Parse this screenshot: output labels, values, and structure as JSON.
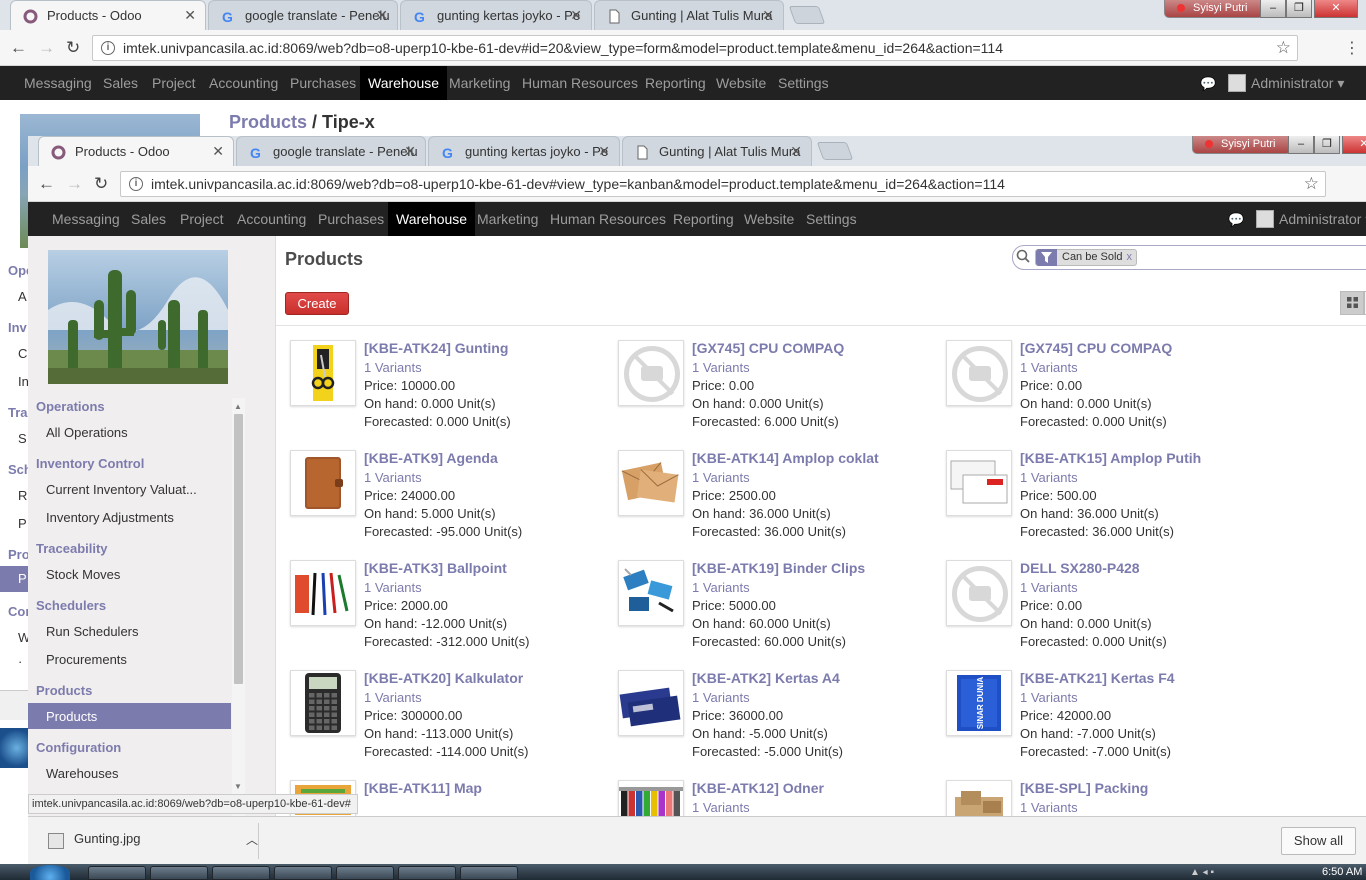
{
  "bg": {
    "tabs": [
      {
        "title": "Products - Odoo",
        "icon": "odoo-icon"
      },
      {
        "title": "google translate - Penelu",
        "icon": "google-icon"
      },
      {
        "title": "gunting kertas joyko - Pe",
        "icon": "google-icon"
      },
      {
        "title": "Gunting | Alat Tulis Mura",
        "icon": "page-icon"
      }
    ],
    "user": "Syisyi Putri",
    "url": "imtek.univpancasila.ac.id:8069/web?db=o8-uperp10-kbe-61-dev#id=20&view_type=form&model=product.template&menu_id=264&action=114",
    "breadcrumb_link": "Products",
    "breadcrumb_sep": " / ",
    "breadcrumb_current": "Tipe-x",
    "side_fragments": [
      "Ope",
      "A",
      "Inv",
      "C",
      "In",
      "Tra",
      "S",
      "Sch",
      "R",
      "P",
      "Pro",
      "P",
      "Con",
      "W",
      "·"
    ]
  },
  "window_controls": {
    "minimize": "–",
    "restore": "❐",
    "close": "✕"
  },
  "tabs": [
    {
      "title": "Products - Odoo",
      "icon": "odoo-icon"
    },
    {
      "title": "google translate - Penelu",
      "icon": "google-icon"
    },
    {
      "title": "gunting kertas joyko - Pe",
      "icon": "google-icon"
    },
    {
      "title": "Gunting | Alat Tulis Mura",
      "icon": "page-icon"
    }
  ],
  "user": "Syisyi Putri",
  "url": "imtek.univpancasila.ac.id:8069/web?db=o8-uperp10-kbe-61-dev#view_type=kanban&model=product.template&menu_id=264&action=114",
  "topmenu": [
    "Messaging",
    "Sales",
    "Project",
    "Accounting",
    "Purchases",
    "Warehouse",
    "Marketing",
    "Human Resources",
    "Reporting",
    "Website",
    "Settings"
  ],
  "active_menu": "Warehouse",
  "admin": "Administrator",
  "sidebar": {
    "sections": [
      {
        "title": "Operations",
        "items": [
          "All Operations"
        ]
      },
      {
        "title": "Inventory Control",
        "items": [
          "Current Inventory Valuat...",
          "Inventory Adjustments"
        ]
      },
      {
        "title": "Traceability",
        "items": [
          "Stock Moves"
        ]
      },
      {
        "title": "Schedulers",
        "items": [
          "Run Schedulers",
          "Procurements"
        ]
      },
      {
        "title": "Products",
        "items": [
          "Products"
        ]
      },
      {
        "title": "Configuration",
        "items": [
          "Warehouses"
        ]
      }
    ],
    "active_item": "Products"
  },
  "page_title": "Products",
  "create_label": "Create",
  "search": {
    "facet": "Can be Sold",
    "facet_remove": "x"
  },
  "products": [
    {
      "name": "[KBE-ATK24] Gunting",
      "variants": "1 Variants",
      "price": "Price: 10000.00",
      "onhand": "On hand: 0.000 Unit(s)",
      "forecast": "Forecasted: 0.000 Unit(s)",
      "img": "scissors"
    },
    {
      "name": "[GX745] CPU COMPAQ",
      "variants": "1 Variants",
      "price": "Price: 0.00",
      "onhand": "On hand: 0.000 Unit(s)",
      "forecast": "Forecasted: 6.000 Unit(s)",
      "img": "none"
    },
    {
      "name": "[GX745] CPU COMPAQ",
      "variants": "1 Variants",
      "price": "Price: 0.00",
      "onhand": "On hand: 0.000 Unit(s)",
      "forecast": "Forecasted: 0.000 Unit(s)",
      "img": "none"
    },
    {
      "name": "[KBE-ATK9] Agenda",
      "variants": "1 Variants",
      "price": "Price: 24000.00",
      "onhand": "On hand: 5.000 Unit(s)",
      "forecast": "Forecasted: -95.000 Unit(s)",
      "img": "agenda"
    },
    {
      "name": "[KBE-ATK14] Amplop coklat",
      "variants": "1 Variants",
      "price": "Price: 2500.00",
      "onhand": "On hand: 36.000 Unit(s)",
      "forecast": "Forecasted: 36.000 Unit(s)",
      "img": "envelope-brown"
    },
    {
      "name": "[KBE-ATK15] Amplop Putih",
      "variants": "1 Variants",
      "price": "Price: 500.00",
      "onhand": "On hand: 36.000 Unit(s)",
      "forecast": "Forecasted: 36.000 Unit(s)",
      "img": "envelope-white"
    },
    {
      "name": "[KBE-ATK3] Ballpoint",
      "variants": "1 Variants",
      "price": "Price: 2000.00",
      "onhand": "On hand: -12.000 Unit(s)",
      "forecast": "Forecasted: -312.000 Unit(s)",
      "img": "pens"
    },
    {
      "name": "[KBE-ATK19] Binder Clips",
      "variants": "1 Variants",
      "price": "Price: 5000.00",
      "onhand": "On hand: 60.000 Unit(s)",
      "forecast": "Forecasted: 60.000 Unit(s)",
      "img": "clips"
    },
    {
      "name": "DELL SX280-P428",
      "variants": "1 Variants",
      "price": "Price: 0.00",
      "onhand": "On hand: 0.000 Unit(s)",
      "forecast": "Forecasted: 0.000 Unit(s)",
      "img": "none"
    },
    {
      "name": "[KBE-ATK20] Kalkulator",
      "variants": "1 Variants",
      "price": "Price: 300000.00",
      "onhand": "On hand: -113.000 Unit(s)",
      "forecast": "Forecasted: -114.000 Unit(s)",
      "img": "calculator"
    },
    {
      "name": "[KBE-ATK2] Kertas A4",
      "variants": "1 Variants",
      "price": "Price: 36000.00",
      "onhand": "On hand: -5.000 Unit(s)",
      "forecast": "Forecasted: -5.000 Unit(s)",
      "img": "paper-a4"
    },
    {
      "name": "[KBE-ATK21] Kertas F4",
      "variants": "1 Variants",
      "price": "Price: 42000.00",
      "onhand": "On hand: -7.000 Unit(s)",
      "forecast": "Forecasted: -7.000 Unit(s)",
      "img": "paper-f4",
      "img_label": "SINAR DUNIA"
    },
    {
      "name": "[KBE-ATK11] Map",
      "variants": "",
      "price": "",
      "onhand": "",
      "forecast": "",
      "img": "map"
    },
    {
      "name": "[KBE-ATK12] Odner",
      "variants": "1 Variants",
      "price": "",
      "onhand": "",
      "forecast": "",
      "img": "odner"
    },
    {
      "name": "[KBE-SPL] Packing",
      "variants": "1 Variants",
      "price": "",
      "onhand": "",
      "forecast": "",
      "img": "packing"
    }
  ],
  "status_url": "imtek.univpancasila.ac.id:8069/web?db=o8-uperp10-kbe-61-dev#",
  "download": {
    "file": "Gunting.jpg",
    "show_all": "Show all"
  },
  "clock": "6:50 AM",
  "colors": {
    "odoo_purple": "#7c7bad",
    "create_red": "#d9534f",
    "topbar": "#222222"
  }
}
